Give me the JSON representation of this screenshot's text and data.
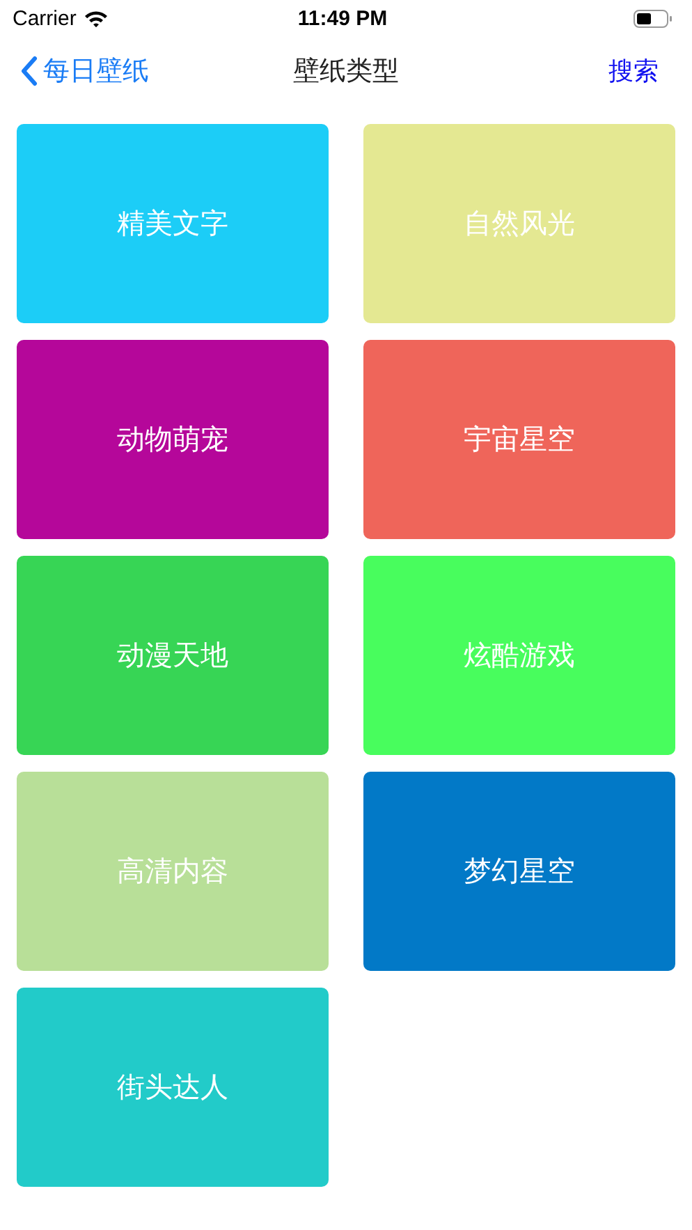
{
  "status_bar": {
    "carrier": "Carrier",
    "time": "11:49 PM"
  },
  "nav": {
    "back": "每日壁纸",
    "title": "壁纸类型",
    "action": "搜索"
  },
  "categories": [
    {
      "label": "精美文字",
      "color": "#1ccdf7"
    },
    {
      "label": "自然风光",
      "color": "#e4e892"
    },
    {
      "label": "动物萌宠",
      "color": "#b5079a"
    },
    {
      "label": "宇宙星空",
      "color": "#ef655a"
    },
    {
      "label": "动漫天地",
      "color": "#37d555"
    },
    {
      "label": "炫酷游戏",
      "color": "#48fd5d"
    },
    {
      "label": "高清内容",
      "color": "#b8df98"
    },
    {
      "label": "梦幻星空",
      "color": "#0279c7"
    },
    {
      "label": "街头达人",
      "color": "#22cbc9"
    }
  ]
}
